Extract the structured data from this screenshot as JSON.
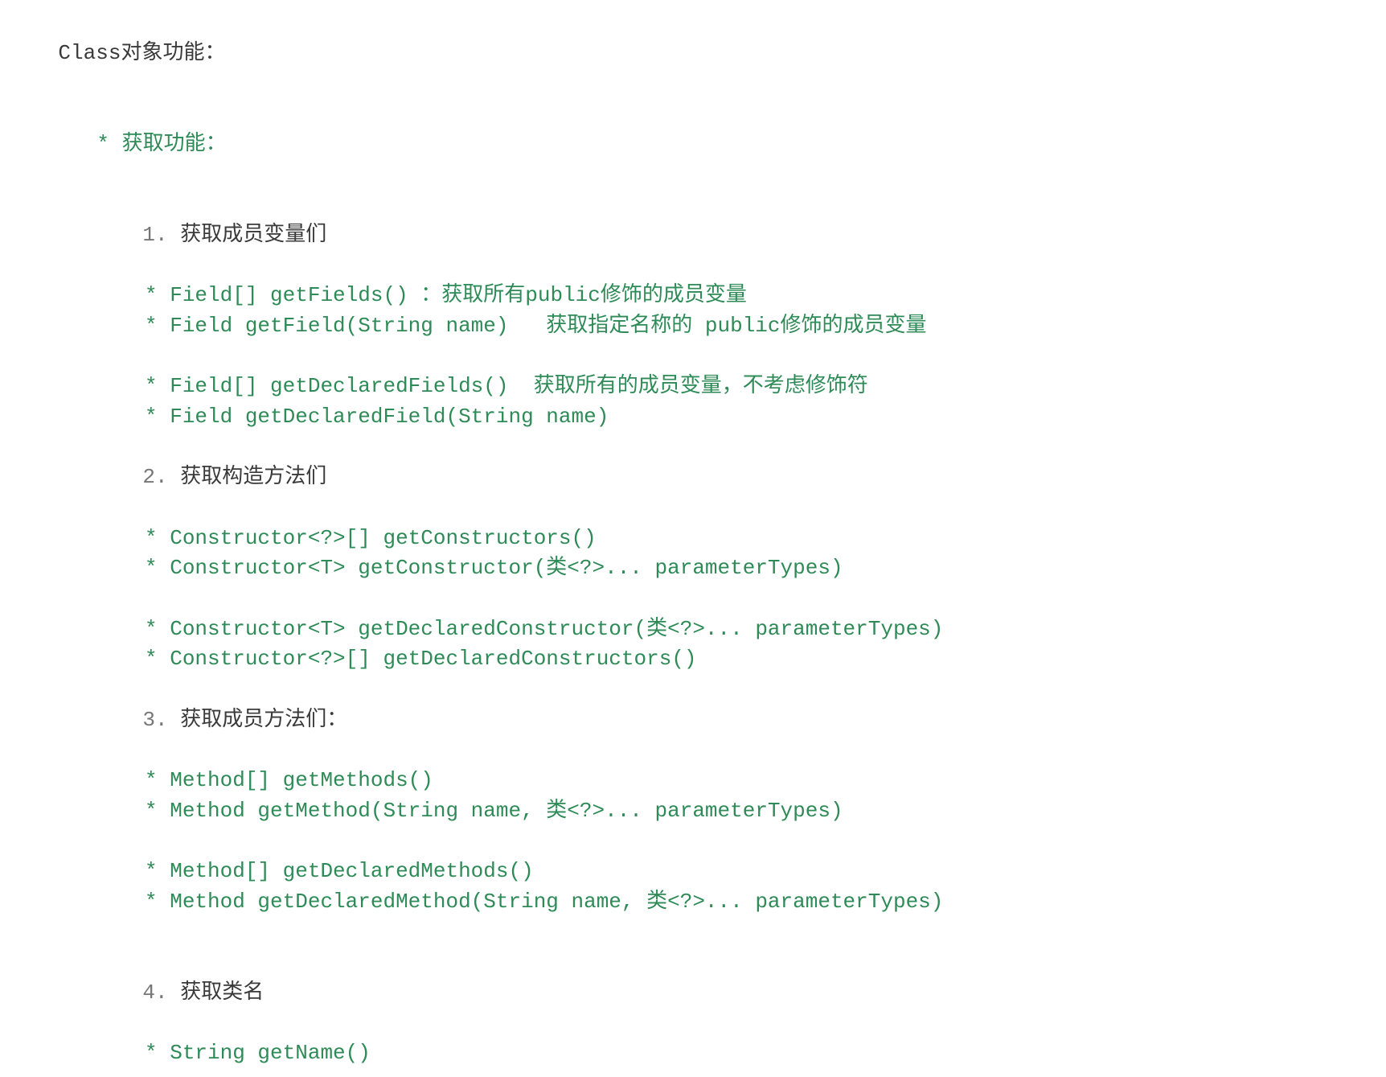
{
  "title_prefix": "Class",
  "title_rest": "对象功能：",
  "bullet": "* ",
  "header_get": "获取功能：",
  "sections": {
    "s1": {
      "num": "1. ",
      "head": "获取成员变量们",
      "items": [
        "Field[] getFields() ：获取所有public修饰的成员变量",
        "Field getField(String name)   获取指定名称的 public修饰的成员变量",
        "",
        "Field[] getDeclaredFields()  获取所有的成员变量，不考虑修饰符",
        "Field getDeclaredField(String name)"
      ]
    },
    "s2": {
      "num": "2. ",
      "head": "获取构造方法们",
      "items": [
        "Constructor<?>[] getConstructors()",
        "Constructor<T> getConstructor(类<?>... parameterTypes)",
        "",
        "Constructor<T> getDeclaredConstructor(类<?>... parameterTypes)",
        "Constructor<?>[] getDeclaredConstructors()"
      ]
    },
    "s3": {
      "num": "3. ",
      "head": "获取成员方法们：",
      "items": [
        "Method[] getMethods()",
        "Method getMethod(String name, 类<?>... parameterTypes)",
        "",
        "Method[] getDeclaredMethods()",
        "Method getDeclaredMethod(String name, 类<?>... parameterTypes)"
      ]
    },
    "s4": {
      "num": "4. ",
      "head": "获取类名",
      "items": [
        "String getName()"
      ]
    }
  }
}
